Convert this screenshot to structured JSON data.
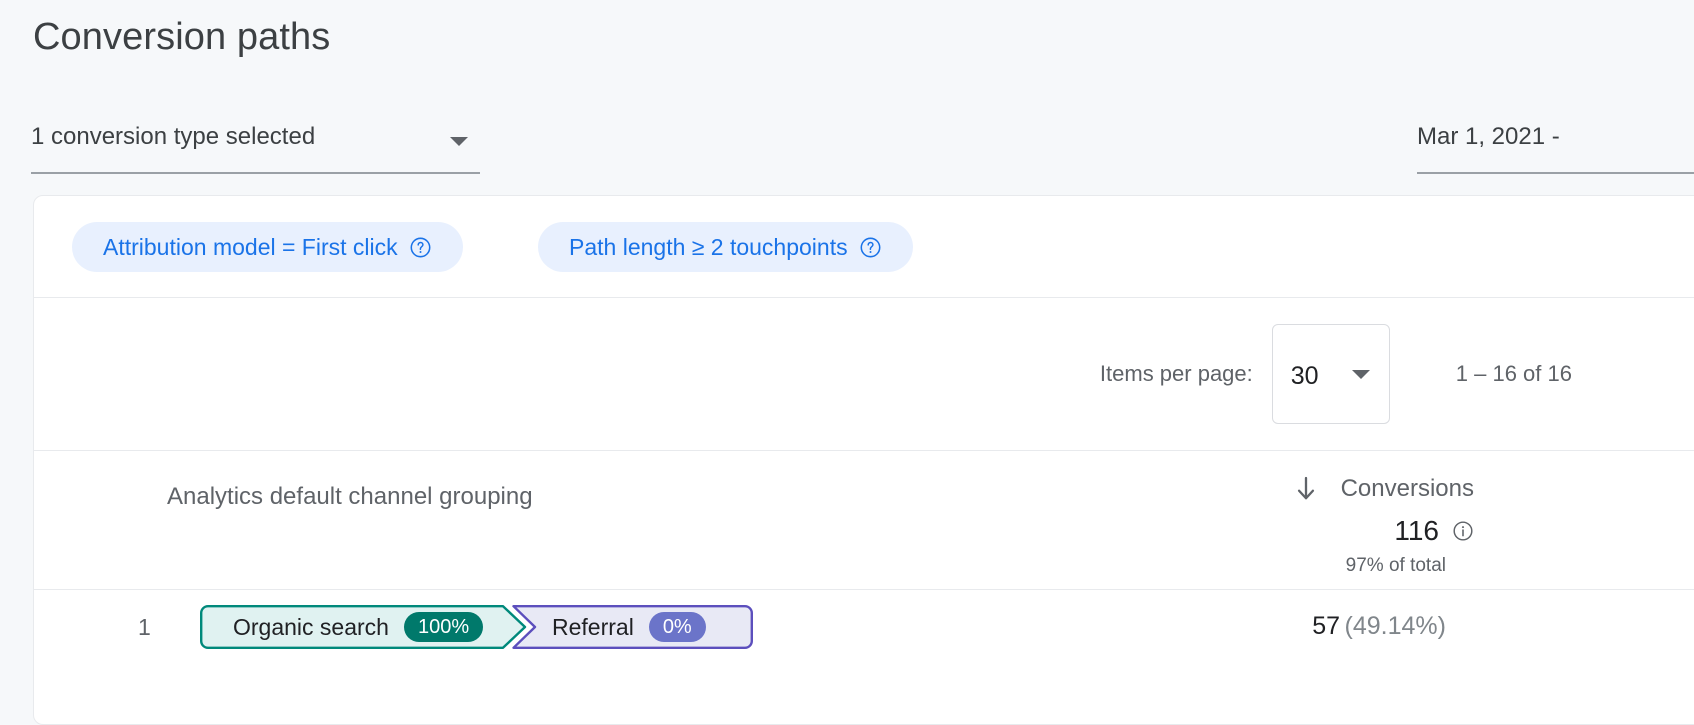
{
  "page": {
    "title": "Conversion paths",
    "background_color": "#f6f8fa"
  },
  "controls": {
    "conversion_type_selector": {
      "label": "1 conversion type selected",
      "icon": "chevron-down-icon"
    },
    "date_range": {
      "label": "Mar 1, 2021 -"
    }
  },
  "filters": {
    "chips": [
      {
        "label": "Attribution model = First click",
        "help_icon": "help-circle-icon"
      },
      {
        "label": "Path length ≥ 2 touchpoints",
        "help_icon": "help-circle-icon"
      }
    ],
    "chip_bg_color": "#e8f0fe",
    "chip_text_color": "#1a73e8"
  },
  "pagination": {
    "items_per_page_label": "Items per page:",
    "items_per_page_value": "30",
    "items_per_page_caret": "chevron-down-icon",
    "range_label": "1 – 16 of 16"
  },
  "table": {
    "dimension_header": "Analytics default channel grouping",
    "metric": {
      "sort_icon": "arrow-down-icon",
      "name": "Conversions",
      "value": "116",
      "info_icon": "info-circle-icon",
      "subtext": "97% of total"
    },
    "rows": [
      {
        "index": "1",
        "steps": [
          {
            "label": "Organic search",
            "badge": "100%",
            "fill_color": "#e0f2f1",
            "border_color": "#00897b",
            "badge_color": "#00796b"
          },
          {
            "label": "Referral",
            "badge": "0%",
            "fill_color": "#e8e9f5",
            "border_color": "#5c4fbd",
            "badge_color": "#6b74c9"
          }
        ],
        "value": "57",
        "percent": "(49.14%)"
      }
    ]
  }
}
